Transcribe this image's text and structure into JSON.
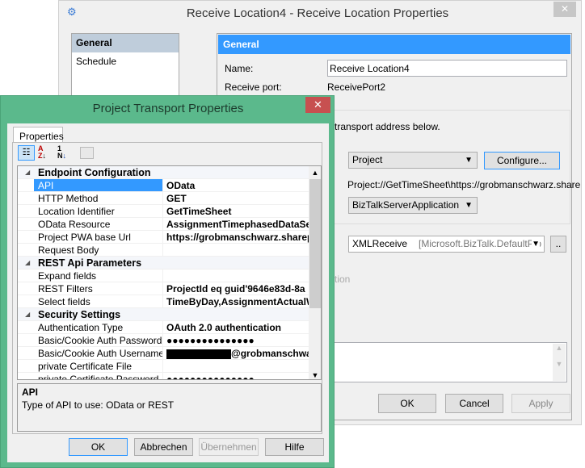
{
  "back_window": {
    "title": "Receive Location4 - Receive Location Properties",
    "close": "✕",
    "nav": [
      {
        "label": "General",
        "selected": true
      },
      {
        "label": "Schedule",
        "selected": false
      }
    ],
    "panel_header": "General",
    "name_label": "Name:",
    "name_value": "Receive Location4",
    "port_label": "Receive port:",
    "port_value": "ReceivePort2",
    "transport_hint": "transport address below.",
    "transport_type": "Project",
    "configure": "Configure...",
    "uri": "Project://GetTimeSheet\\https://grobmanschwarz.share",
    "handler": "BizTalkServerApplication",
    "pipeline": "XMLReceive",
    "pipeline_assembly": "[Microsoft.BizTalk.DefaultPip",
    "ellipsis": "..",
    "faded_text": "tion",
    "ok": "OK",
    "cancel": "Cancel",
    "apply": "Apply",
    "accent": "#3399ff"
  },
  "dialog": {
    "title": "Project Transport Properties",
    "close": "✕",
    "tab": "Properties",
    "border_color": "#5bb98c",
    "rows": [
      {
        "type": "cat",
        "label": "Endpoint Configuration"
      },
      {
        "label": "API",
        "value": "OData",
        "selected": true
      },
      {
        "label": "HTTP Method",
        "value": "GET"
      },
      {
        "label": "Location Identifier",
        "value": "GetTimeSheet"
      },
      {
        "label": "OData Resource",
        "value": "AssignmentTimephasedDataSet"
      },
      {
        "label": "Project PWA base Url",
        "value": "https://grobmanschwarz.sharepoint"
      },
      {
        "label": "Request Body",
        "value": ""
      },
      {
        "type": "cat",
        "label": "REST Api Parameters"
      },
      {
        "label": "Expand fields",
        "value": ""
      },
      {
        "label": "REST Filters",
        "value": "ProjectId eq guid'9646e83d-8a"
      },
      {
        "label": "Select fields",
        "value": "TimeByDay,AssignmentActualW"
      },
      {
        "type": "cat",
        "label": "Security Settings"
      },
      {
        "label": "Authentication Type",
        "value": "OAuth 2.0 authentication"
      },
      {
        "label": "Basic/Cookie Auth Password",
        "value": "●●●●●●●●●●●●●●●"
      },
      {
        "label": "Basic/Cookie Auth Username",
        "value": "@grobmanschwarz",
        "redacted": true
      },
      {
        "label": "private Certificate File",
        "value": ""
      },
      {
        "label": "private Certificate Password",
        "value": "●●●●●●●●●●●●●●●"
      }
    ],
    "desc_title": "API",
    "desc_text": "Type of API to use: OData or REST",
    "ok": "OK",
    "cancel": "Abbrechen",
    "apply": "Übernehmen",
    "help": "Hilfe"
  }
}
